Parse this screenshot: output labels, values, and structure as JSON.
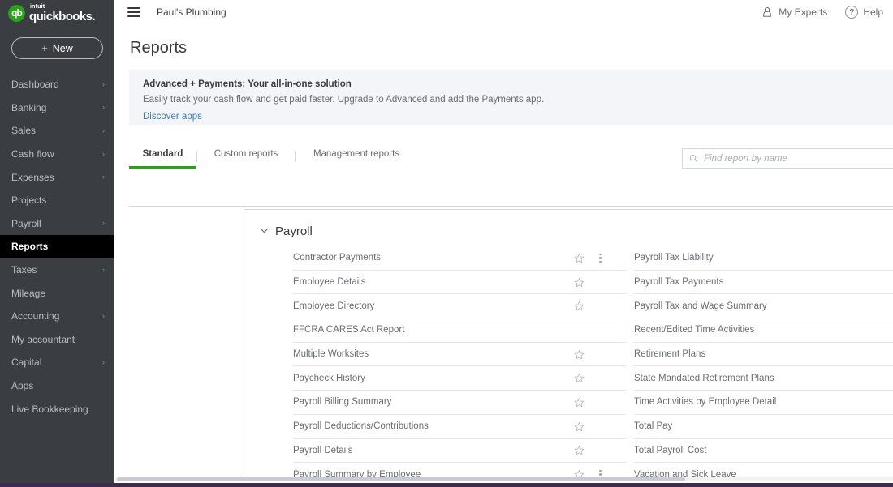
{
  "brand": {
    "mark": "qb",
    "intuit": "intuit",
    "name": "quickbooks."
  },
  "sidebar": {
    "new_button": {
      "plus": "+",
      "label": "New"
    },
    "items": [
      {
        "label": "Dashboard",
        "chevron": "›",
        "active": false
      },
      {
        "label": "Banking",
        "chevron": "›",
        "active": false
      },
      {
        "label": "Sales",
        "chevron": "›",
        "active": false
      },
      {
        "label": "Cash flow",
        "chevron": "›",
        "active": false
      },
      {
        "label": "Expenses",
        "chevron": "›",
        "active": false
      },
      {
        "label": "Projects",
        "chevron": "",
        "active": false
      },
      {
        "label": "Payroll",
        "chevron": "›",
        "active": false
      },
      {
        "label": "Reports",
        "chevron": "",
        "active": true
      },
      {
        "label": "Taxes",
        "chevron": "›",
        "active": false
      },
      {
        "label": "Mileage",
        "chevron": "",
        "active": false
      },
      {
        "label": "Accounting",
        "chevron": "›",
        "active": false
      },
      {
        "label": "My accountant",
        "chevron": "",
        "active": false
      },
      {
        "label": "Capital",
        "chevron": "›",
        "active": false
      },
      {
        "label": "Apps",
        "chevron": "",
        "active": false
      },
      {
        "label": "Live Bookkeeping",
        "chevron": "",
        "active": false
      }
    ]
  },
  "topbar": {
    "company": "Paul's Plumbing",
    "my_experts": "My Experts",
    "help": "Help",
    "help_glyph": "?"
  },
  "page": {
    "title": "Reports"
  },
  "promo": {
    "title": "Advanced + Payments: Your all-in-one solution",
    "subtitle": "Easily track your cash flow and get paid faster. Upgrade to Advanced and add the Payments app.",
    "link": "Discover apps"
  },
  "search": {
    "placeholder": "Find report by name",
    "value": ""
  },
  "tabs": [
    {
      "label": "Standard",
      "active": true
    },
    {
      "label": "Custom reports",
      "active": false
    },
    {
      "label": "Management reports",
      "active": false
    }
  ],
  "group": {
    "caret": "⌄",
    "title": "Payroll"
  },
  "reports": {
    "left": [
      {
        "name": "Contractor Payments",
        "star": true,
        "kebab": true
      },
      {
        "name": "Employee Details",
        "star": true,
        "kebab": false
      },
      {
        "name": "Employee Directory",
        "star": true,
        "kebab": false
      },
      {
        "name": "FFCRA CARES Act Report",
        "star": false,
        "kebab": false
      },
      {
        "name": "Multiple Worksites",
        "star": true,
        "kebab": false
      },
      {
        "name": "Paycheck History",
        "star": true,
        "kebab": false
      },
      {
        "name": "Payroll Billing Summary",
        "star": true,
        "kebab": false
      },
      {
        "name": "Payroll Deductions/Contributions",
        "star": true,
        "kebab": false
      },
      {
        "name": "Payroll Details",
        "star": true,
        "kebab": false
      },
      {
        "name": "Payroll Summary by Employee",
        "star": true,
        "kebab": true
      }
    ],
    "right": [
      {
        "name": "Payroll Tax Liability",
        "star": true,
        "kebab": false
      },
      {
        "name": "Payroll Tax Payments",
        "star": true,
        "kebab": false
      },
      {
        "name": "Payroll Tax and Wage Summary",
        "star": true,
        "kebab": false
      },
      {
        "name": "Recent/Edited Time Activities",
        "star": true,
        "kebab": true
      },
      {
        "name": "Retirement Plans",
        "star": true,
        "kebab": false
      },
      {
        "name": "State Mandated Retirement Plans",
        "star": true,
        "kebab": true
      },
      {
        "name": "Time Activities by Employee Detail",
        "star": true,
        "kebab": true
      },
      {
        "name": "Total Pay",
        "star": true,
        "kebab": false
      },
      {
        "name": "Total Payroll Cost",
        "star": true,
        "kebab": false
      },
      {
        "name": "Vacation and Sick Leave",
        "star": true,
        "kebab": false
      }
    ]
  },
  "colors": {
    "brand_green": "#2ca01c",
    "sidebar_bg": "#3a3d42",
    "active_bg": "#000000",
    "link_blue": "#2f7fbd",
    "bottom_bar": "#3f2b4d"
  }
}
